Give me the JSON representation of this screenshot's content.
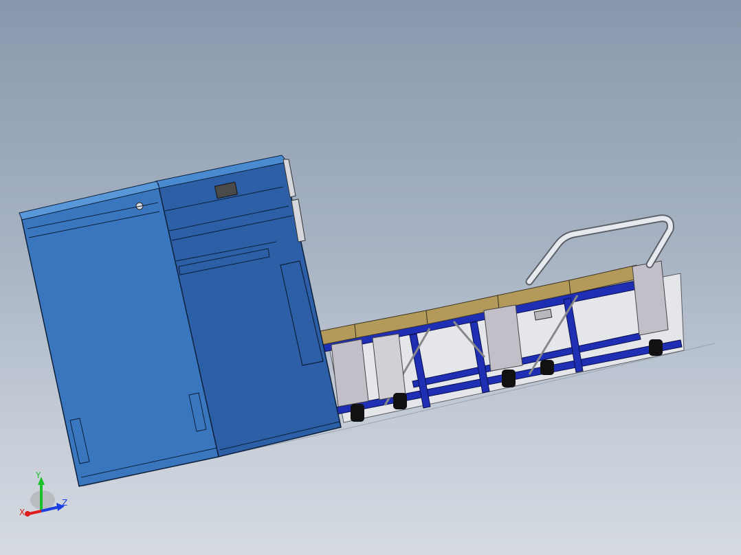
{
  "viewport": {
    "background_top": "#8898ac",
    "background_bottom": "#d6dbe2"
  },
  "model": {
    "cabinet_color": "#3a76bd",
    "cabinet_side_color": "#2c5fa5",
    "frame_color": "#1f2fb3",
    "cushion_color": "#b49a5a",
    "panel_color": "#c3bfc8",
    "rail_color": "#d7dce3"
  },
  "triad": {
    "x_label": "X",
    "y_label": "Y",
    "z_label": "Z",
    "x_color": "#e01b1b",
    "y_color": "#19c02a",
    "z_color": "#1b3ee0"
  }
}
